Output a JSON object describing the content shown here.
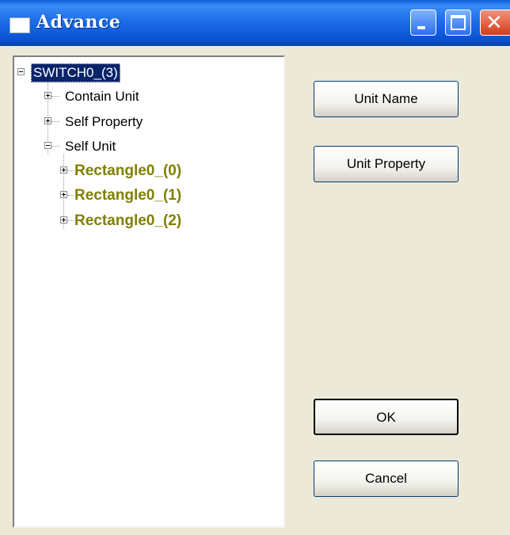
{
  "window": {
    "title": "Advance"
  },
  "tree": {
    "root": "SWITCH0_(3)",
    "children": [
      {
        "label": "Contain Unit"
      },
      {
        "label": "Self Property"
      },
      {
        "label": "Self Unit",
        "children": [
          "Rectangle0_(0)",
          "Rectangle0_(1)",
          "Rectangle0_(2)"
        ]
      }
    ]
  },
  "buttons": {
    "unit_name": "Unit Name",
    "unit_property": "Unit Property",
    "ok": "OK",
    "cancel": "Cancel"
  },
  "icons": [
    "app-icon",
    "minimize-icon",
    "maximize-icon",
    "close-icon",
    "tree-expand-icon",
    "tree-collapse-icon"
  ],
  "colors": {
    "title_bar": "#0a5ed8",
    "selection": "#0a246a",
    "rect_nodes": "#808000",
    "dialog_bg": "#ece9d8"
  }
}
